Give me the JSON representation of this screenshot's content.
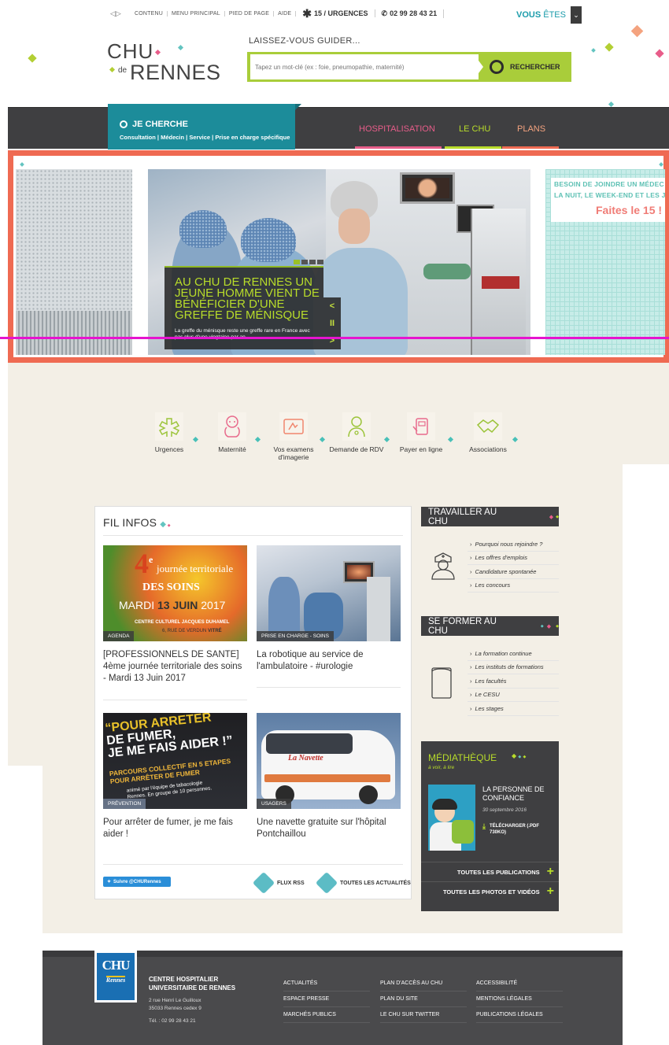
{
  "topbar": {
    "links": [
      "CONTENU",
      "MENU PRINCIPAL",
      "PIED DE PAGE",
      "AIDE"
    ],
    "urgences": "15 / URGENCES",
    "phone": "02 99 28 43 21",
    "vous_etes_bold": "VOUS",
    "vous_etes_rest": " ÊTES"
  },
  "logo": {
    "chu": "CHU",
    "de": "de",
    "rennes": "RENNES"
  },
  "search": {
    "label": "LAISSEZ-VOUS GUIDER...",
    "placeholder": "Tapez un mot-clé (ex : foie, pneumopathie, maternité)",
    "button": "RECHERCHER"
  },
  "nav": {
    "cherche_title": "JE CHERCHE",
    "cherche_sub": "Consultation | Médecin | Service | Prise en charge spécifique",
    "items": [
      "HOSPITALISATION",
      "LE CHU",
      "PLANS"
    ]
  },
  "hero": {
    "title": "AU CHU DE RENNES UN JEUNE HOMME VIENT DE BÉNÉFICIER D'UNE GREFFE DE MÉNISQUE",
    "desc": "La greffe du ménisque reste une greffe rare en France avec pas plus d'une vingtaine par an",
    "controls": [
      "<",
      "II",
      ">"
    ],
    "side_line1": "BESOIN DE JOINDRE UN MÉDEC",
    "side_line2": "LA NUIT, LE WEEK-END ET LES JO",
    "side_line3": "Faites le 15 !"
  },
  "quick_access": [
    "Urgences",
    "Maternité",
    "Vos examens d'imagerie",
    "Demande de RDV",
    "Payer en ligne",
    "Associations"
  ],
  "fil_infos": {
    "title": "FIL INFOS",
    "news": [
      {
        "tag": "AGENDA",
        "title": "[PROFESSIONNELS DE SANTE] 4ème journée territoriale des soins - Mardi 13 Juin 2017",
        "img_big": "4",
        "img_sup": "e",
        "img_line1": "journée territoriale",
        "img_line2": "DES SOINS",
        "img_date_a": "MARDI",
        "img_date_b": "13 JUIN",
        "img_date_c": "2017",
        "img_place": "CENTRE CULTUREL JACQUES DUHAMEL",
        "img_addr_a": "6, RUE DE VERDUN",
        "img_addr_b": "VITRÉ"
      },
      {
        "tag": "PRISE EN CHARGE - SOINS",
        "title": "La robotique au service de l'ambulatoire - #urologie"
      },
      {
        "tag": "PRÉVENTION",
        "title": "Pour arrêter de fumer, je me fais aider !",
        "img_l1": "“POUR ARRETER",
        "img_l2": "DE FUMER,",
        "img_l3": "JE ME FAIS AIDER !”",
        "img_l4": "PARCOURS COLLECTIF EN 5 ETAPES",
        "img_l5": "POUR ARRÊTER DE FUMER",
        "img_l6": "animé par l'équipe de tabacologie",
        "img_l7": "Rennes. En groupe de 10 personnes."
      },
      {
        "tag": "USAGERS",
        "title": "Une navette gratuite sur l'hôpital Pontchaillou",
        "img_brand": "La Navette"
      }
    ],
    "twitter": "Suivre @CHURennes",
    "rss": "FLUX RSS",
    "all_news": "TOUTES LES ACTUALITÉS"
  },
  "travailler": {
    "title": "TRAVAILLER AU CHU",
    "links": [
      "Pourquoi nous rejoindre ?",
      "Les offres d'emplois",
      "Candidature spontanée",
      "Les concours"
    ]
  },
  "former": {
    "title": "SE FORMER AU CHU",
    "links": [
      "La formation continue",
      "Les instituts de formations",
      "Les facultés",
      "Le CESU",
      "Les stages"
    ]
  },
  "mediatheque": {
    "title": "MÉDIATHÈQUE",
    "subtitle": "à voir, à lire",
    "doc_title": "LA PERSONNE DE CONFIANCE",
    "doc_date": "30 septembre 2016",
    "download": "TÉLÉCHARGER (.PDF 730KO)",
    "all_pubs": "TOUTES LES PUBLICATIONS",
    "all_media": "TOUTES LES PHOTOS ET VIDÉOS"
  },
  "footer": {
    "logo_text": "CHU",
    "logo_sub": "Rennes",
    "org_line1": "CENTRE HOSPITALIER",
    "org_line2": "UNIVERSITAIRE DE RENNES",
    "addr1": "2 rue Henri Le Guilloux",
    "addr2": "35033 Rennes cedex 9",
    "tel": "Tél. : 02 99 28 43 21",
    "col1": [
      "ACTUALITÉS",
      "ESPACE PRESSE",
      "MARCHÉS PUBLICS"
    ],
    "col2": [
      "PLAN D'ACCÈS AU CHU",
      "PLAN DU SITE",
      "LE CHU SUR TWITTER"
    ],
    "col3": [
      "ACCESSIBILITÉ",
      "MENTIONS LÉGALES",
      "PUBLICATIONS LÉGALES"
    ]
  },
  "colors": {
    "teal": "#1c8c9a",
    "lime": "#a9cd3a",
    "coral": "#ef6a52",
    "dark": "#3f3f41",
    "pink": "#e85d8a"
  }
}
